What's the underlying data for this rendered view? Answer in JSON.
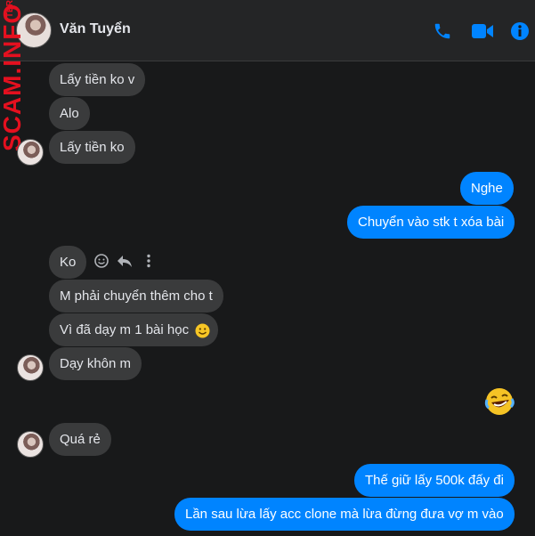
{
  "header": {
    "contact_name": "Văn Tuyển"
  },
  "watermark": {
    "text": "SCAM.INFO",
    "top_text": "TER"
  },
  "messages": [
    {
      "side": "in",
      "text": "Lấy tiền ko v"
    },
    {
      "side": "in",
      "text": "Alo"
    },
    {
      "side": "in",
      "text": "Lấy tiền ko"
    },
    {
      "side": "out",
      "text": "Nghe"
    },
    {
      "side": "out",
      "text": "Chuyển vào stk t xóa bài"
    },
    {
      "side": "in",
      "text": "Ko"
    },
    {
      "side": "in",
      "text": "M phải chuyển thêm cho t"
    },
    {
      "side": "in",
      "text": "Vì đã dạy m 1 bài học"
    },
    {
      "side": "in",
      "text": "Dạy khôn m"
    },
    {
      "side": "out",
      "text": ""
    },
    {
      "side": "in",
      "text": "Quá rẻ"
    },
    {
      "side": "out",
      "text": "Thế giữ lấy 500k đấy đi"
    },
    {
      "side": "out",
      "text": "Lần sau lừa lấy acc clone mà lừa đừng đưa vợ m vào"
    }
  ],
  "icons": {
    "call": "phone-icon",
    "video": "video-icon",
    "info": "info-icon",
    "react": "smile-icon",
    "reply": "reply-icon",
    "more": "more-icon",
    "emoji_smile": "smiling-face-emoji",
    "emoji_laugh": "rolling-laughing-emoji"
  },
  "colors": {
    "background": "#18191a",
    "header": "#242526",
    "incoming_bubble": "#3a3b3c",
    "outgoing_bubble": "#0084ff",
    "accent": "#0084ff",
    "watermark": "#e4101f"
  }
}
